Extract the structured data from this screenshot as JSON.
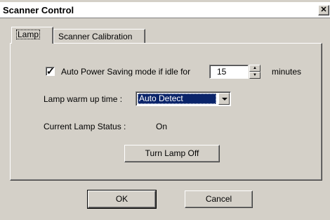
{
  "window": {
    "title": "Scanner Control"
  },
  "tabs": {
    "lamp": "Lamp",
    "calibration": "Scanner Calibration"
  },
  "lamp_tab": {
    "auto_power": {
      "checked": true,
      "label": "Auto Power Saving mode if idle for",
      "value": "15",
      "unit": "minutes"
    },
    "warmup": {
      "label": "Lamp warm up time :",
      "selected": "Auto Detect"
    },
    "status": {
      "label": "Current Lamp Status :",
      "value": "On"
    },
    "toggle_button": "Turn Lamp Off"
  },
  "footer": {
    "ok": "OK",
    "cancel": "Cancel"
  },
  "icons": {
    "close": "close-icon",
    "check": "check-icon",
    "spin_up": "up-arrow-icon",
    "spin_down": "down-arrow-icon",
    "dropdown": "chevron-down-icon"
  }
}
